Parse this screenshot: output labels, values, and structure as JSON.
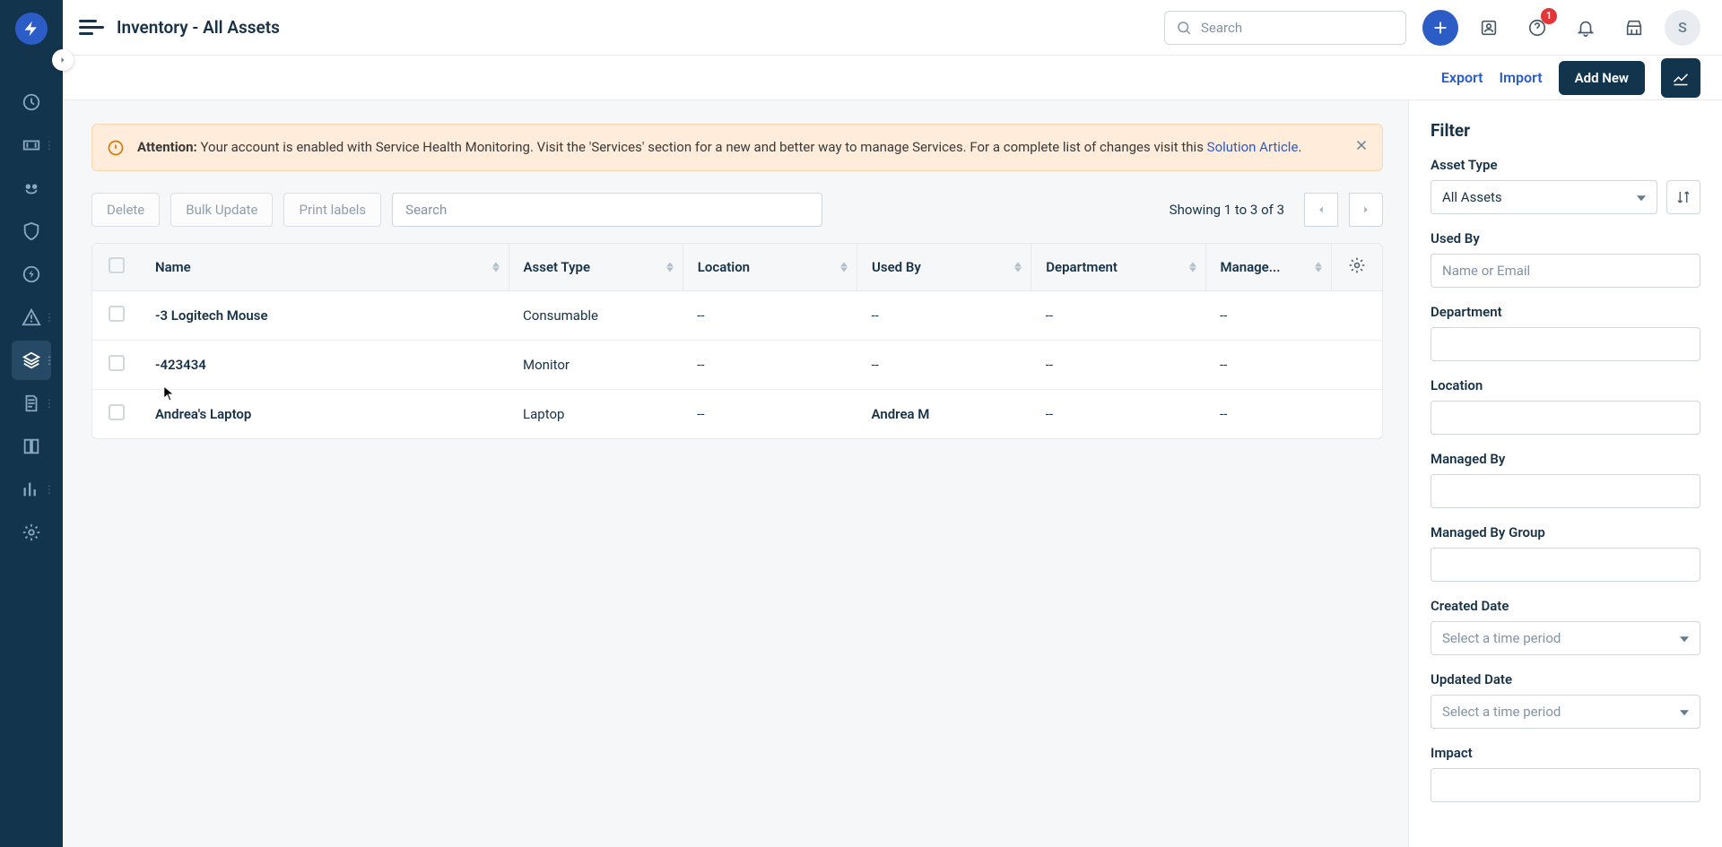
{
  "header": {
    "title": "Inventory - All Assets",
    "search_placeholder": "Search",
    "notification_count": "1",
    "avatar": "S"
  },
  "actions": {
    "export": "Export",
    "import": "Import",
    "add_new": "Add New"
  },
  "alert": {
    "prefix": "Attention:",
    "text": " Your account is enabled with Service Health Monitoring. Visit the 'Services' section for a new and better way to manage Services. For a complete list of changes visit this ",
    "link": "Solution Article",
    "suffix": "."
  },
  "toolbar": {
    "delete": "Delete",
    "bulk_update": "Bulk Update",
    "print_labels": "Print labels",
    "search_placeholder": "Search",
    "pagination": "Showing 1 to 3 of 3"
  },
  "table": {
    "columns": {
      "name": "Name",
      "asset_type": "Asset Type",
      "location": "Location",
      "used_by": "Used By",
      "department": "Department",
      "managed": "Manage..."
    },
    "rows": [
      {
        "name": "-3 Logitech Mouse",
        "asset_type": "Consumable",
        "location": "--",
        "used_by": "--",
        "department": "--",
        "managed": "--"
      },
      {
        "name": "-423434",
        "asset_type": "Monitor",
        "location": "--",
        "used_by": "--",
        "department": "--",
        "managed": "--"
      },
      {
        "name": "Andrea's Laptop",
        "asset_type": "Laptop",
        "location": "--",
        "used_by": "Andrea M",
        "department": "--",
        "managed": "--"
      }
    ]
  },
  "filter": {
    "title": "Filter",
    "asset_type_label": "Asset Type",
    "asset_type_value": "All Assets",
    "used_by_label": "Used By",
    "used_by_placeholder": "Name or Email",
    "department_label": "Department",
    "location_label": "Location",
    "managed_by_label": "Managed By",
    "managed_by_group_label": "Managed By Group",
    "created_date_label": "Created Date",
    "created_date_placeholder": "Select a time period",
    "updated_date_label": "Updated Date",
    "updated_date_placeholder": "Select a time period",
    "impact_label": "Impact"
  }
}
